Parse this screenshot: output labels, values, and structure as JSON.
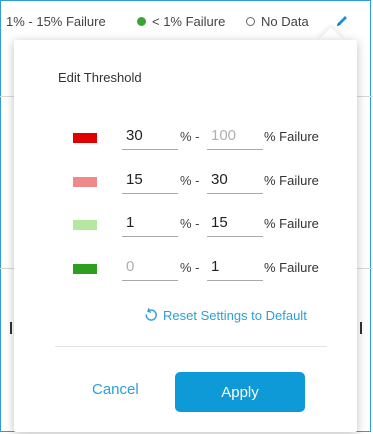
{
  "legend": {
    "items": [
      {
        "label": "1% - 15% Failure",
        "marker": "none"
      },
      {
        "label": "< 1% Failure",
        "marker": "filled-dot",
        "color": "#3aa335"
      },
      {
        "label": "No Data",
        "marker": "empty-dot",
        "color": "#666666"
      }
    ],
    "edit_icon": "pencil-icon"
  },
  "threshold": {
    "title": "Edit Threshold",
    "separator": "% -",
    "unit": "% Failure",
    "rows": [
      {
        "color": "#e00000",
        "min": "30",
        "max": "100",
        "max_muted": true,
        "min_muted": false
      },
      {
        "color": "#f08a8a",
        "min": "15",
        "max": "30",
        "max_muted": false,
        "min_muted": false
      },
      {
        "color": "#b6e7a0",
        "min": "1",
        "max": "15",
        "max_muted": false,
        "min_muted": false
      },
      {
        "color": "#2d9e1e",
        "min": "0",
        "max": "1",
        "max_muted": false,
        "min_muted": true
      }
    ],
    "reset_label": "Reset Settings to Default",
    "reset_icon": "reset-icon"
  },
  "actions": {
    "cancel_label": "Cancel",
    "apply_label": "Apply"
  },
  "colors": {
    "accent": "#2b9fd8",
    "apply_bg": "#0d9ad6"
  }
}
